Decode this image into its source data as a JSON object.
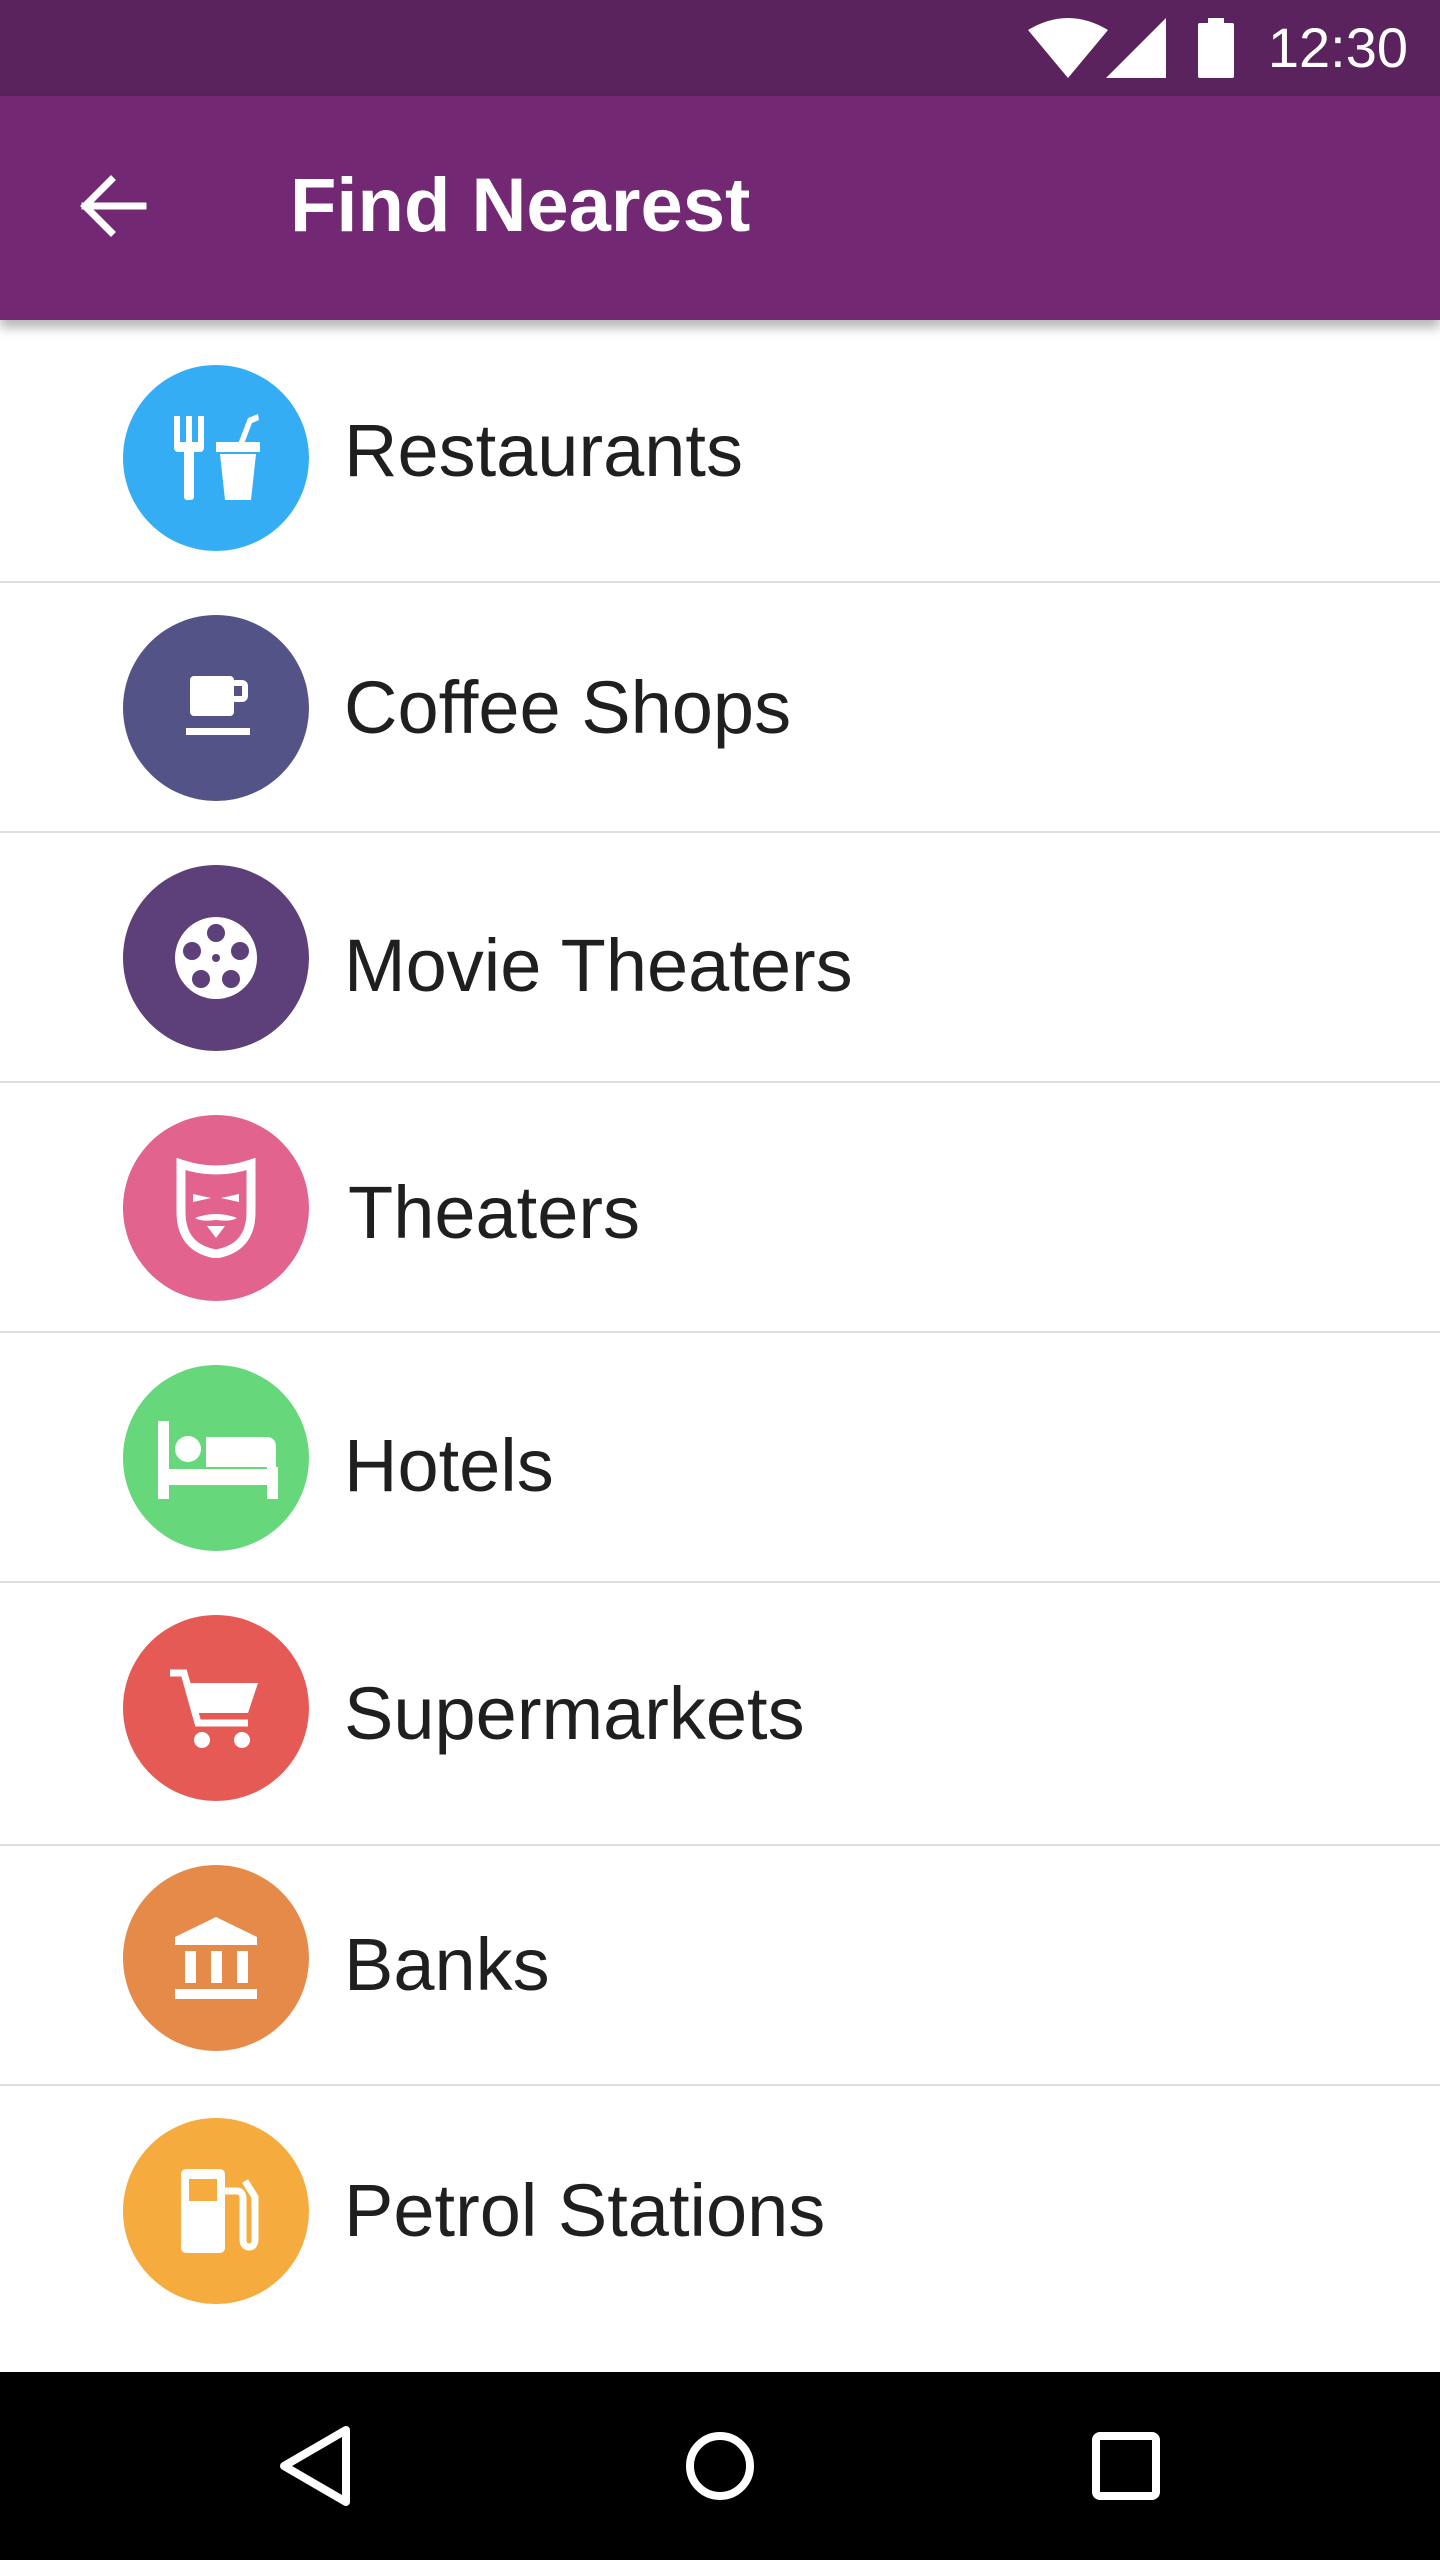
{
  "status_bar": {
    "time": "12:30",
    "icons": [
      "wifi-icon",
      "cellular-signal-icon",
      "battery-icon"
    ],
    "background": "#5b235e"
  },
  "app_bar": {
    "title": "Find Nearest",
    "back_icon": "arrow-back-icon",
    "background": "#732873"
  },
  "categories": [
    {
      "label": "Restaurants",
      "icon": "restaurant-icon",
      "color": "#35adf5"
    },
    {
      "label": "Coffee Shops",
      "icon": "coffee-icon",
      "color": "#545388"
    },
    {
      "label": "Movie Theaters",
      "icon": "film-reel-icon",
      "color": "#5d3f79"
    },
    {
      "label": "Theaters",
      "icon": "theater-mask-icon",
      "color": "#e2638e"
    },
    {
      "label": "Hotels",
      "icon": "bed-icon",
      "color": "#66d77a"
    },
    {
      "label": "Supermarkets",
      "icon": "shopping-cart-icon",
      "color": "#e65a55"
    },
    {
      "label": "Banks",
      "icon": "bank-icon",
      "color": "#e58a48"
    },
    {
      "label": "Petrol Stations",
      "icon": "fuel-pump-icon",
      "color": "#f5ab3e"
    }
  ],
  "nav_bar": {
    "buttons": [
      "back-triangle-icon",
      "home-circle-icon",
      "recents-square-icon"
    ]
  }
}
